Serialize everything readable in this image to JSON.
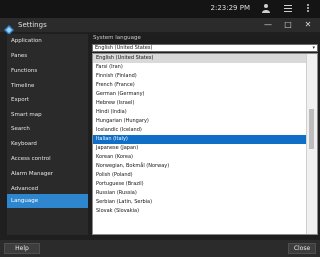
{
  "system": {
    "clock": "2:23:29 PM"
  },
  "window": {
    "title": "Settings"
  },
  "sidebar": {
    "items": [
      {
        "label": "Application"
      },
      {
        "label": "Panes"
      },
      {
        "label": "Functions"
      },
      {
        "label": "Timeline"
      },
      {
        "label": "Export"
      },
      {
        "label": "Smart map"
      },
      {
        "label": "Search"
      },
      {
        "label": "Keyboard"
      },
      {
        "label": "Access control"
      },
      {
        "label": "Alarm Manager"
      },
      {
        "label": "Advanced"
      },
      {
        "label": "Language"
      }
    ],
    "active_index": 11
  },
  "language": {
    "section_label": "System language",
    "selected_value": "English (United States)",
    "options": [
      "English (United States)",
      "Farsi (Iran)",
      "Finnish (Finland)",
      "French (France)",
      "German (Germany)",
      "Hebrew (Israel)",
      "Hindi (India)",
      "Hungarian (Hungary)",
      "Icelandic (Iceland)",
      "Italian (Italy)",
      "Japanese (Japan)",
      "Korean (Korea)",
      "Norwegian, Bokmål (Norway)",
      "Polish (Poland)",
      "Portuguese (Brazil)",
      "Russian (Russia)",
      "Serbian (Latin, Serbia)",
      "Slovak (Slovakia)"
    ],
    "selected_index": 0,
    "highlighted_index": 9
  },
  "footer": {
    "help_label": "Help",
    "close_label": "Close"
  },
  "colors": {
    "accent": "#2e86cf",
    "highlight": "#0f6fc6"
  }
}
